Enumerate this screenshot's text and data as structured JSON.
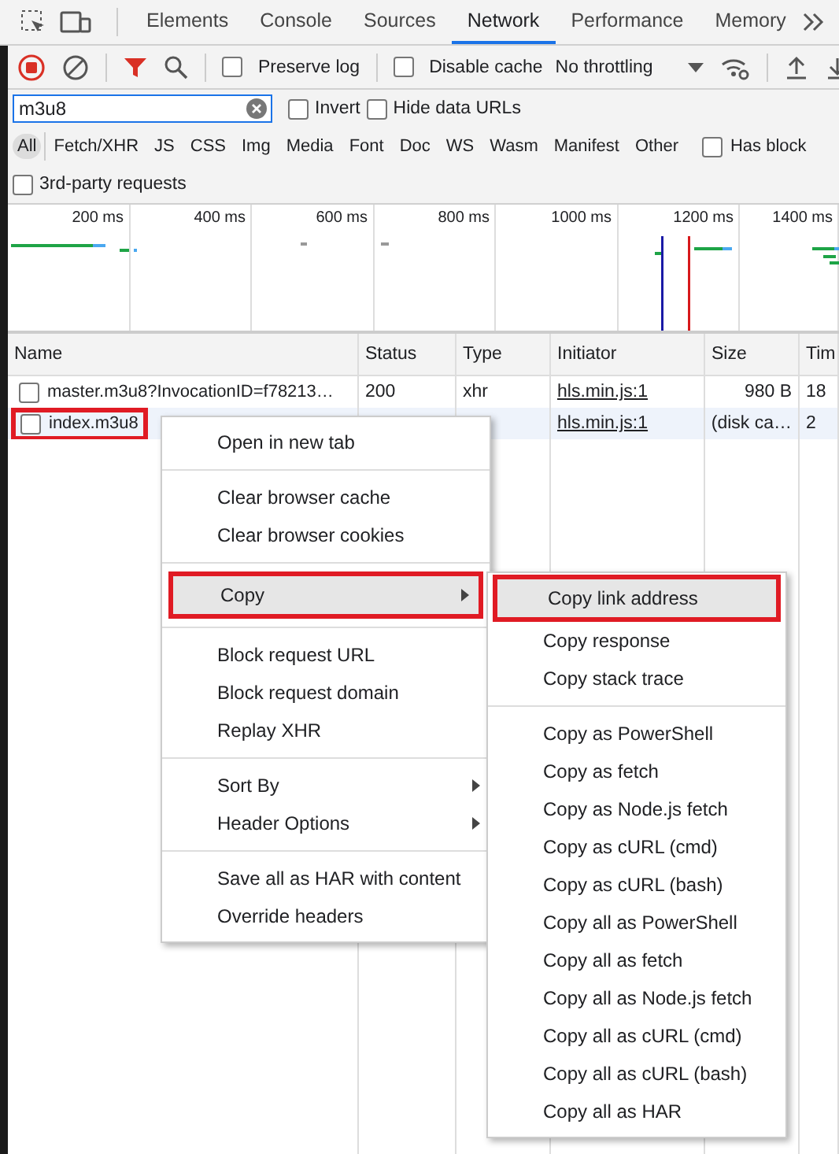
{
  "tabs": [
    {
      "label": "Elements",
      "selected": false
    },
    {
      "label": "Console",
      "selected": false
    },
    {
      "label": "Sources",
      "selected": false
    },
    {
      "label": "Network",
      "selected": true
    },
    {
      "label": "Performance",
      "selected": false
    },
    {
      "label": "Memory",
      "selected": false
    }
  ],
  "toolbar": {
    "recording": true,
    "filter_active": true,
    "checks": [
      {
        "label": "Preserve log",
        "checked": false
      },
      {
        "label": "Disable cache",
        "checked": false
      }
    ],
    "throttling": "No throttling"
  },
  "filter": {
    "value": "m3u8",
    "checks": [
      {
        "label": "Invert",
        "checked": false
      },
      {
        "label": "Hide data URLs",
        "checked": false
      }
    ]
  },
  "type_filters": [
    {
      "label": "All",
      "selected": true
    },
    {
      "label": "Fetch/XHR",
      "selected": false
    },
    {
      "label": "JS",
      "selected": false
    },
    {
      "label": "CSS",
      "selected": false
    },
    {
      "label": "Img",
      "selected": false
    },
    {
      "label": "Media",
      "selected": false
    },
    {
      "label": "Font",
      "selected": false
    },
    {
      "label": "Doc",
      "selected": false
    },
    {
      "label": "WS",
      "selected": false
    },
    {
      "label": "Wasm",
      "selected": false
    },
    {
      "label": "Manifest",
      "selected": false
    },
    {
      "label": "Other",
      "selected": false
    }
  ],
  "has_blocked": {
    "label": "Has block",
    "checked": false
  },
  "third_party": {
    "label": "3rd-party requests",
    "checked": false
  },
  "overview": {
    "ticks": [
      "200 ms",
      "400 ms",
      "600 ms",
      "800 ms",
      "1000 ms",
      "1200 ms",
      "1400 ms"
    ]
  },
  "table": {
    "columns": [
      "Name",
      "Status",
      "Type",
      "Initiator",
      "Size",
      "Tim"
    ],
    "rows": [
      {
        "name": "master.m3u8?InvocationID=f78213…",
        "status": "200",
        "type": "xhr",
        "initiator": "hls.min.js:1",
        "size": "980 B",
        "time": "18",
        "checked": false,
        "selected": false,
        "outlined": false
      },
      {
        "name": "index.m3u8",
        "initiator": "hls.min.js:1",
        "size": "(disk ca…",
        "time": "2",
        "checked": false,
        "selected": true,
        "outlined": true
      }
    ]
  },
  "context_menu": {
    "groups": [
      [
        {
          "label": "Open in new tab",
          "has_submenu": false,
          "highlighted": false,
          "outlined": false
        }
      ],
      [
        {
          "label": "Clear browser cache",
          "has_submenu": false,
          "highlighted": false,
          "outlined": false
        },
        {
          "label": "Clear browser cookies",
          "has_submenu": false,
          "highlighted": false,
          "outlined": false
        }
      ],
      [
        {
          "label": "Copy",
          "has_submenu": true,
          "highlighted": true,
          "outlined": true
        }
      ],
      [
        {
          "label": "Block request URL",
          "has_submenu": false,
          "highlighted": false,
          "outlined": false
        },
        {
          "label": "Block request domain",
          "has_submenu": false,
          "highlighted": false,
          "outlined": false
        },
        {
          "label": "Replay XHR",
          "has_submenu": false,
          "highlighted": false,
          "outlined": false
        }
      ],
      [
        {
          "label": "Sort By",
          "has_submenu": true,
          "highlighted": false,
          "outlined": false
        },
        {
          "label": "Header Options",
          "has_submenu": true,
          "highlighted": false,
          "outlined": false
        }
      ],
      [
        {
          "label": "Save all as HAR with content",
          "has_submenu": false,
          "highlighted": false,
          "outlined": false
        },
        {
          "label": "Override headers",
          "has_submenu": false,
          "highlighted": false,
          "outlined": false
        }
      ]
    ]
  },
  "submenu": {
    "groups": [
      [
        {
          "label": "Copy link address",
          "has_submenu": false,
          "highlighted": true,
          "outlined": true
        },
        {
          "label": "Copy response",
          "has_submenu": false,
          "highlighted": false,
          "outlined": false
        },
        {
          "label": "Copy stack trace",
          "has_submenu": false,
          "highlighted": false,
          "outlined": false
        }
      ],
      [
        {
          "label": "Copy as PowerShell",
          "has_submenu": false,
          "highlighted": false,
          "outlined": false
        },
        {
          "label": "Copy as fetch",
          "has_submenu": false,
          "highlighted": false,
          "outlined": false
        },
        {
          "label": "Copy as Node.js fetch",
          "has_submenu": false,
          "highlighted": false,
          "outlined": false
        },
        {
          "label": "Copy as cURL (cmd)",
          "has_submenu": false,
          "highlighted": false,
          "outlined": false
        },
        {
          "label": "Copy as cURL (bash)",
          "has_submenu": false,
          "highlighted": false,
          "outlined": false
        },
        {
          "label": "Copy all as PowerShell",
          "has_submenu": false,
          "highlighted": false,
          "outlined": false
        },
        {
          "label": "Copy all as fetch",
          "has_submenu": false,
          "highlighted": false,
          "outlined": false
        },
        {
          "label": "Copy all as Node.js fetch",
          "has_submenu": false,
          "highlighted": false,
          "outlined": false
        },
        {
          "label": "Copy all as cURL (cmd)",
          "has_submenu": false,
          "highlighted": false,
          "outlined": false
        },
        {
          "label": "Copy all as cURL (bash)",
          "has_submenu": false,
          "highlighted": false,
          "outlined": false
        },
        {
          "label": "Copy all as HAR",
          "has_submenu": false,
          "highlighted": false,
          "outlined": false
        }
      ]
    ]
  }
}
